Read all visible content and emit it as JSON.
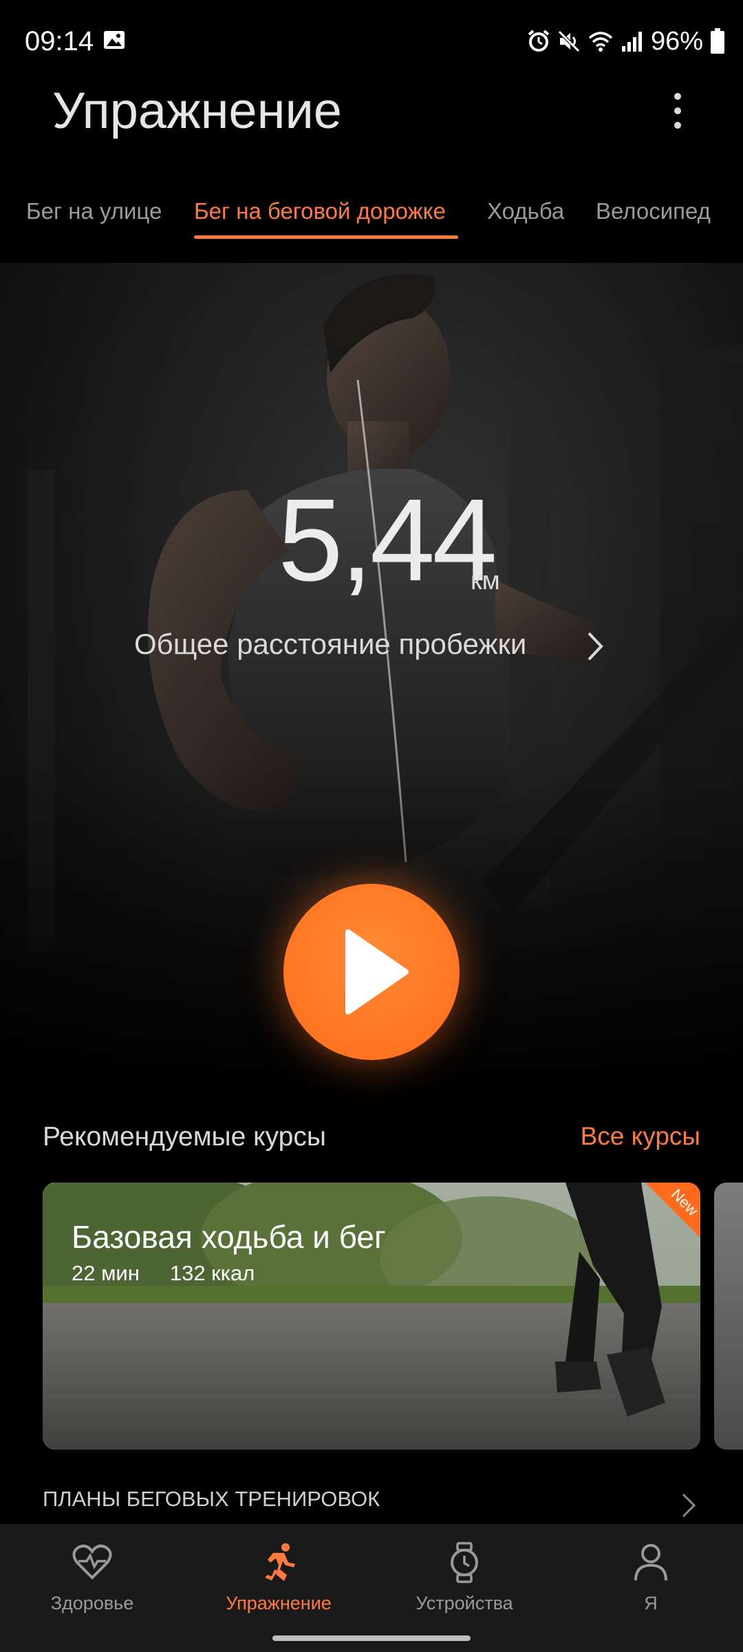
{
  "status_bar": {
    "time": "09:14",
    "battery": "96%",
    "icons": [
      "image-icon",
      "alarm-icon",
      "mute-icon",
      "wifi-icon",
      "signal-icon",
      "battery-icon"
    ]
  },
  "header": {
    "title": "Упражнение",
    "more_icon": "more-vert-icon"
  },
  "tabs": [
    {
      "label": "Бег на улице",
      "active": false
    },
    {
      "label": "Бег на беговой дорожке",
      "active": true
    },
    {
      "label": "Ходьба",
      "active": false
    },
    {
      "label": "Велосипед",
      "active": false
    }
  ],
  "hero": {
    "distance": "5,44",
    "unit": "км",
    "label": "Общее расстояние пробежки",
    "play_icon": "play-icon"
  },
  "recommended": {
    "title": "Рекомендуемые курсы",
    "all_link": "Все курсы",
    "course": {
      "name": "Базовая ходьба и бег",
      "duration": "22 мин",
      "calories": "132 ккал",
      "badge": "New"
    }
  },
  "plans": {
    "title": "ПЛАНЫ БЕГОВЫХ ТРЕНИРОВОК"
  },
  "bottom_nav": [
    {
      "label": "Здоровье",
      "icon": "heart-pulse-icon",
      "active": false
    },
    {
      "label": "Упражнение",
      "icon": "runner-icon",
      "active": true
    },
    {
      "label": "Устройства",
      "icon": "watch-icon",
      "active": false
    },
    {
      "label": "Я",
      "icon": "person-icon",
      "active": false
    }
  ],
  "colors": {
    "accent": "#ff7a3d",
    "background": "#000000",
    "nav_background": "#1a1a1a"
  }
}
